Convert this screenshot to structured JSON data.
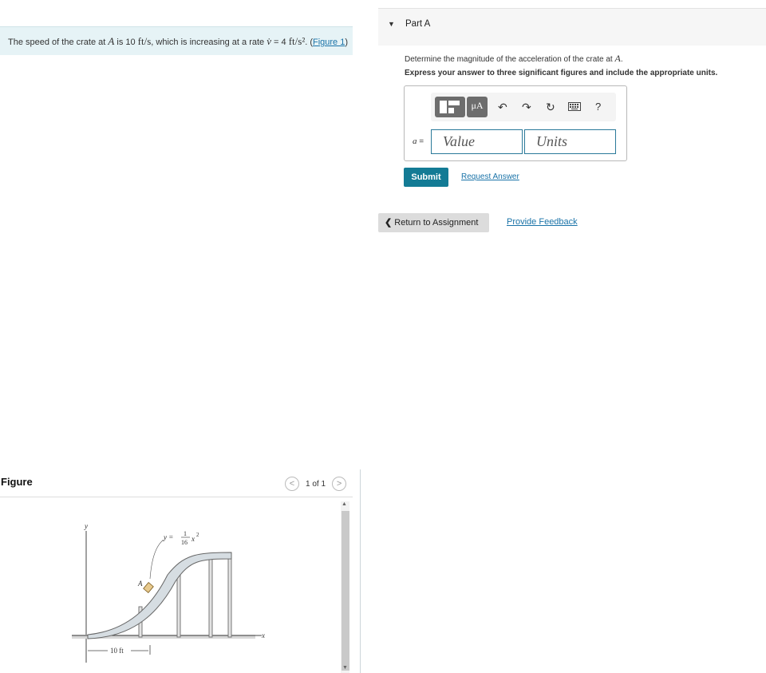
{
  "problem": {
    "text_before": "The speed of the crate at ",
    "point": "A",
    "text_mid1": " is 10 ",
    "speed_unit": "ft/s",
    "text_mid2": ", which is increasing at a rate ",
    "vdot": "v̇",
    "text_mid3": " = 4 ",
    "accel_unit": "ft/s²",
    "text_after": ". (",
    "figure_link": "Figure 1",
    "close_paren": ")"
  },
  "figure": {
    "heading": "Figure",
    "counter": "1 of 1",
    "prev_glyph": "<",
    "next_glyph": ">",
    "labels": {
      "y_axis": "y",
      "x_axis": "x",
      "point": "A",
      "eq_prefix": "y =",
      "eq_num": "1",
      "eq_den": "16",
      "eq_var": "x",
      "eq_exp": "2",
      "dimension": "10 ft"
    }
  },
  "part": {
    "title": "Part A",
    "question_prefix": "Determine the magnitude of the acceleration of the crate at ",
    "question_point": "A",
    "question_suffix": ".",
    "instruction": "Express your answer to three significant figures and include the appropriate units.",
    "toolbar_units_label": "μA",
    "help_glyph": "?",
    "eq_var": "a",
    "eq_sign": " =",
    "value_placeholder": "Value",
    "units_placeholder": "Units",
    "submit_label": "Submit",
    "request_label": "Request Answer"
  },
  "footer": {
    "return_label": "Return to Assignment",
    "feedback_label": "Provide Feedback"
  },
  "colors": {
    "accent": "#137b95",
    "link": "#1a73a8",
    "problem_bg": "#e6f3f6"
  }
}
